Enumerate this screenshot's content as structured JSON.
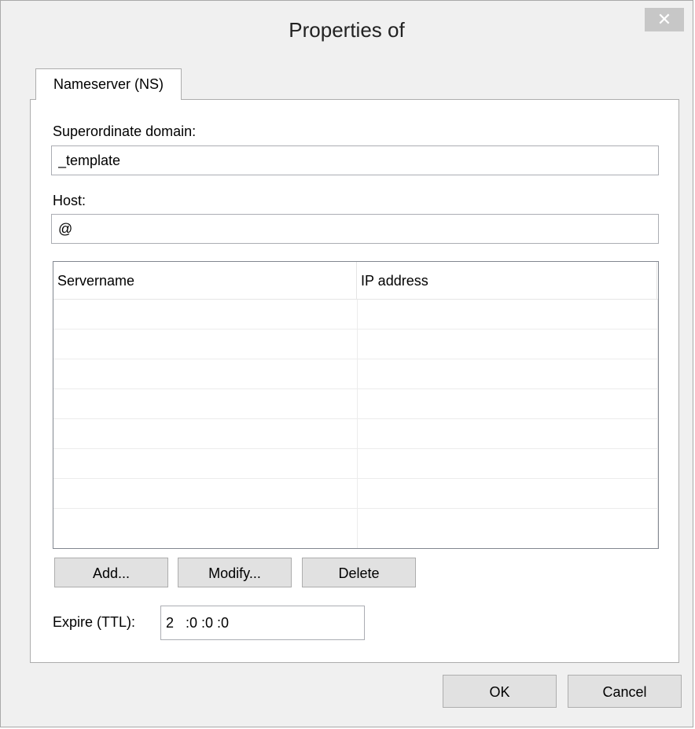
{
  "window": {
    "title": "Properties of",
    "close_glyph": "✕"
  },
  "tabs": [
    {
      "label": "Nameserver (NS)"
    }
  ],
  "form": {
    "superordinate_label": "Superordinate domain:",
    "superordinate_value": "_template",
    "host_label": "Host:",
    "host_value": "@"
  },
  "table": {
    "columns": [
      "Servername",
      "IP address"
    ],
    "rows": []
  },
  "list_buttons": {
    "add": "Add...",
    "modify": "Modify...",
    "delete": "Delete"
  },
  "ttl": {
    "label": "Expire (TTL):",
    "value": "2   :0 :0 :0"
  },
  "footer": {
    "ok": "OK",
    "cancel": "Cancel"
  }
}
